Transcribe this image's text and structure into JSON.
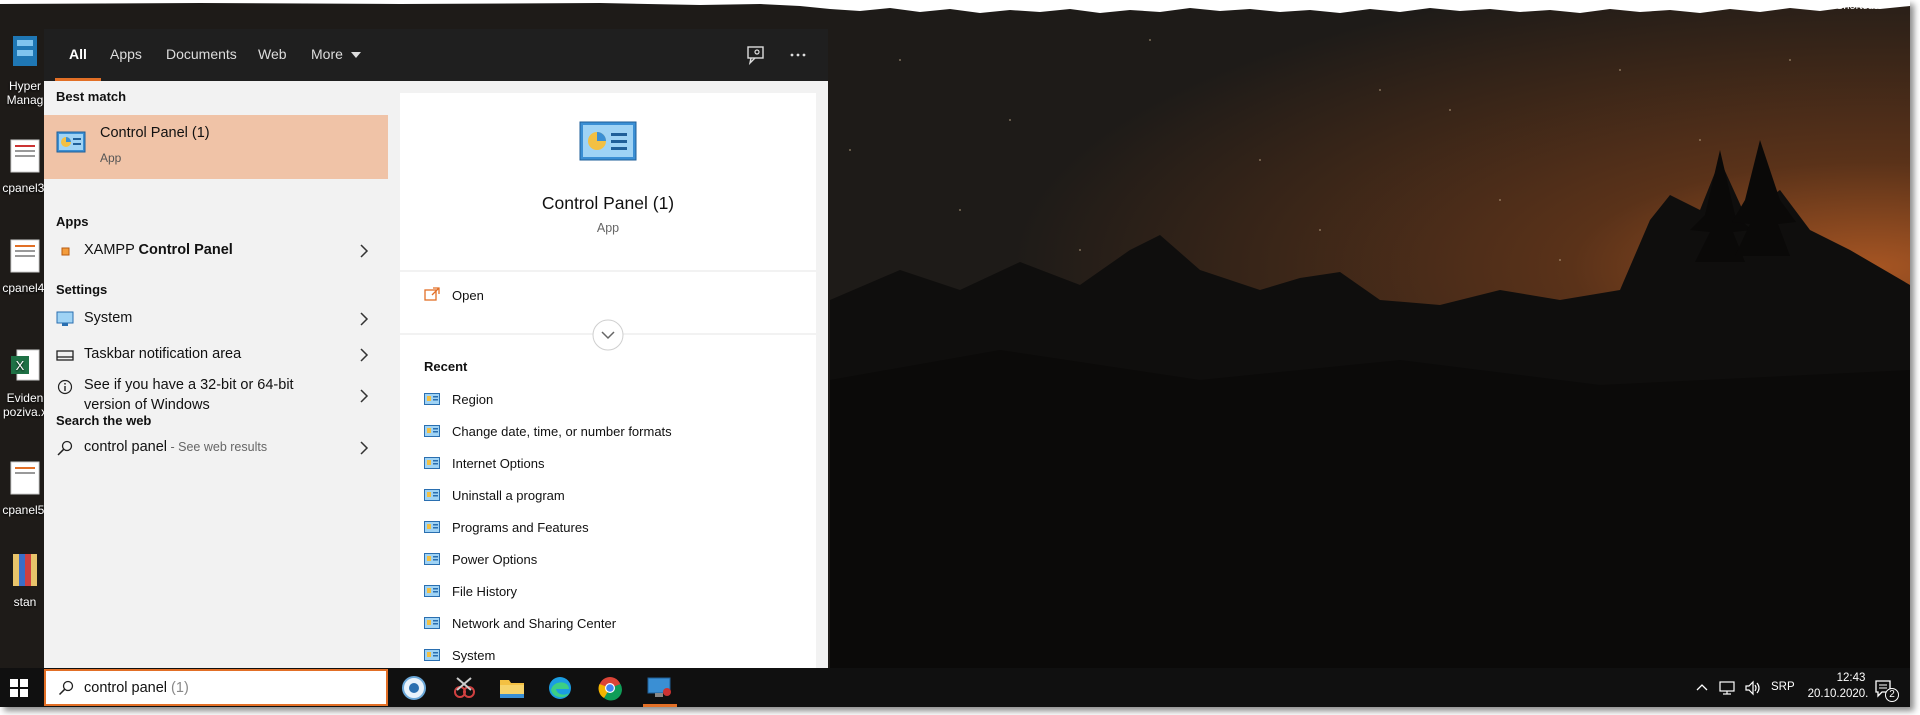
{
  "desktop": {
    "icons": [
      {
        "label_line1": "Hyper",
        "label_line2": "Manag",
        "icon": "hyperv-manager-icon"
      },
      {
        "label_line1": "cpanel3.",
        "icon": "screenshot-file-icon"
      },
      {
        "label_line1": "cpanel4.",
        "icon": "screenshot-file-icon"
      },
      {
        "label_line1": "Eviden",
        "label_line2": "poziva.x",
        "icon": "excel-file-icon"
      },
      {
        "label_line1": "cpanel5.",
        "icon": "screenshot-file-icon"
      },
      {
        "label_line1": "stan",
        "icon": "archive-file-icon"
      }
    ],
    "top_right_text": "Shortcut"
  },
  "search_filters": {
    "tabs": [
      "All",
      "Apps",
      "Documents",
      "Web",
      "More"
    ],
    "active": "All",
    "feedback_icon": "feedback-icon",
    "more_options_icon": "ellipsis-icon"
  },
  "results": {
    "best_match_heading": "Best match",
    "best_match": {
      "title": "Control Panel (1)",
      "subtitle": "App",
      "icon": "control-panel-icon"
    },
    "apps_heading": "Apps",
    "apps": [
      {
        "prefix": "XAMPP ",
        "bold": "Control Panel",
        "icon": "xampp-icon"
      }
    ],
    "settings_heading": "Settings",
    "settings": [
      {
        "label": "System",
        "icon": "monitor-icon"
      },
      {
        "label": "Taskbar notification area",
        "icon": "taskbar-icon"
      },
      {
        "label_line1": "See if you have a 32-bit or 64-bit",
        "label_line2": "version of Windows",
        "icon": "info-icon"
      }
    ],
    "web_heading": "Search the web",
    "web": {
      "query": "control panel",
      "suffix": " - See web results",
      "icon": "search-icon"
    }
  },
  "detail": {
    "title": "Control Panel (1)",
    "subtitle": "App",
    "open_label": "Open",
    "recent_heading": "Recent",
    "recent": [
      "Region",
      "Change date, time, or number formats",
      "Internet Options",
      "Uninstall a program",
      "Programs and Features",
      "Power Options",
      "File History",
      "Network and Sharing Center",
      "System"
    ]
  },
  "taskbar": {
    "search_text": "control panel",
    "search_hint": " (1)",
    "apps": [
      "media-player-icon",
      "snipping-tool-icon",
      "file-explorer-icon",
      "edge-icon",
      "chrome-icon",
      "remote-desktop-icon"
    ],
    "tray": {
      "language": "SRP",
      "time": "12:43",
      "date": "20.10.2020.",
      "notification_count": "2"
    }
  },
  "colors": {
    "accent": "#e26f26",
    "best_match_bg": "#f0c3a7",
    "panel_bg": "#f2f2f2",
    "bar_bg": "#1f1f1f",
    "taskbar_bg": "#101010"
  }
}
